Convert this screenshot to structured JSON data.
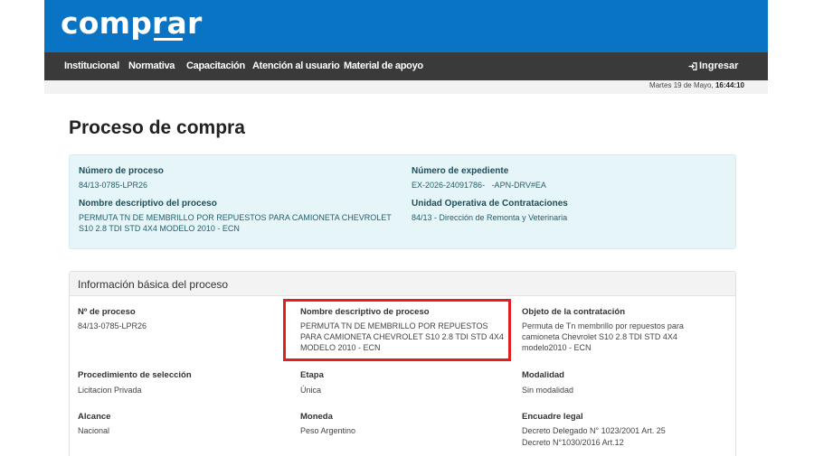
{
  "header": {
    "logo": "comprar"
  },
  "nav": {
    "items": [
      "Institucional",
      "Normativa",
      "Capacitación",
      "Atención al usuario",
      "Material de apoyo"
    ],
    "login_label": "Ingresar"
  },
  "datebar": {
    "date": "Martes 19 de Mayo,",
    "time": "16:44:10"
  },
  "page": {
    "title": "Proceso de compra"
  },
  "summary": {
    "numero_proceso_label": "Número de proceso",
    "numero_proceso": "84/13-0785-LPR26",
    "numero_expediente_label": "Número de expediente",
    "numero_expediente": "EX-2026-24091786-   -APN-DRV#EA",
    "nombre_descriptivo_label": "Nombre descriptivo del proceso",
    "nombre_descriptivo": "PERMUTA TN DE MEMBRILLO POR REPUESTOS PARA CAMIONETA CHEVROLET S10 2.8 TDI STD 4X4 MODELO 2010 - ECN",
    "unidad_label": "Unidad Operativa de Contrataciones",
    "unidad": "84/13 - Dirección de Remonta y Veterinaria"
  },
  "info": {
    "title": "Información básica del proceso",
    "n_proceso_label": "Nº de proceso",
    "n_proceso": "84/13-0785-LPR26",
    "nombre_label": "Nombre descriptivo de proceso",
    "nombre": "PERMUTA TN DE MEMBRILLO POR REPUESTOS PARA CAMIONETA CHEVROLET S10 2.8 TDI STD 4X4 MODELO 2010 - ECN",
    "objeto_label": "Objeto de la contratación",
    "objeto": "Permuta de Tn membrillo por repuestos para camioneta Chevrolet S10 2.8 TDI STD 4X4 modelo2010 - ECN",
    "procedimiento_label": "Procedimiento de selección",
    "procedimiento": "Licitacion Privada",
    "etapa_label": "Etapa",
    "etapa": "Única",
    "modalidad_label": "Modalidad",
    "modalidad": "Sin modalidad",
    "alcance_label": "Alcance",
    "alcance": "Nacional",
    "moneda_label": "Moneda",
    "moneda": "Peso Argentino",
    "encuadre_label": "Encuadre legal",
    "encuadre_1": "Decreto Delegado N° 1023/2001 Art. 25",
    "encuadre_2": "Decreto N°1030/2016 Art.12"
  },
  "colors": {
    "header_blue": "#0a74c4",
    "nav_dark": "#3a3a3a",
    "summary_bg": "#e6f5f8",
    "highlight_red": "#e02020"
  }
}
